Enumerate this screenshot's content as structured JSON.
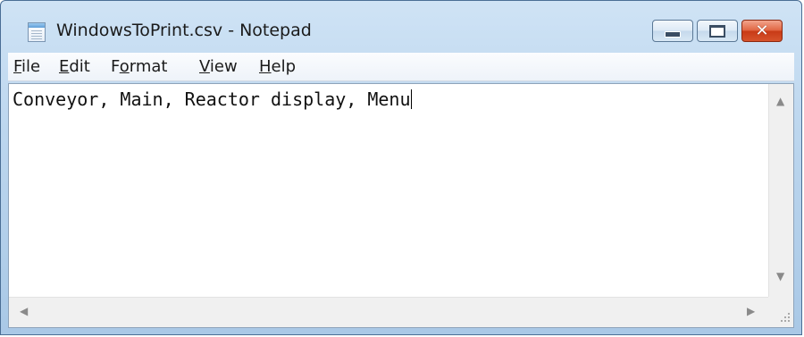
{
  "window": {
    "title": "WindowsToPrint.csv - Notepad",
    "app_icon": "notepad-icon",
    "controls": {
      "minimize_icon": "minimize-icon",
      "maximize_icon": "maximize-icon",
      "close_icon": "close-icon",
      "close_glyph": "✕"
    }
  },
  "menu": {
    "items": [
      {
        "first": "F",
        "rest": "ile"
      },
      {
        "first": "E",
        "rest": "dit"
      },
      {
        "pre": "F",
        "first": "o",
        "rest": "rmat"
      },
      {
        "first": "V",
        "rest": "iew"
      },
      {
        "first": "H",
        "rest": "elp"
      }
    ]
  },
  "editor": {
    "content": "Conveyor, Main, Reactor display, Menu"
  },
  "scrollbars": {
    "up": "▲",
    "down": "▼",
    "left": "◀",
    "right": "▶"
  },
  "colors": {
    "close_button": "#d6532c",
    "window_frame": "#bcd6ee"
  }
}
